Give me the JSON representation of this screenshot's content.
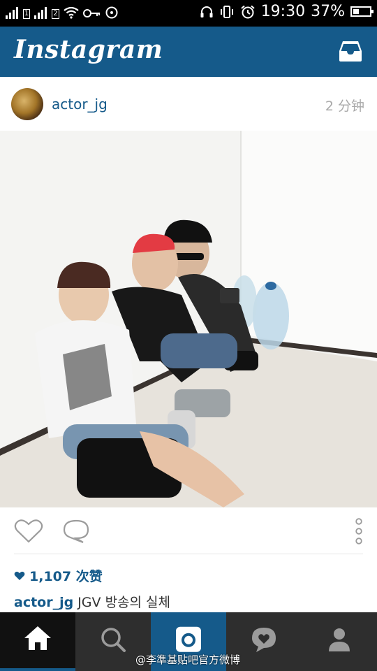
{
  "status_bar": {
    "sim1": "1",
    "sim2": "2",
    "time": "19:30",
    "battery_percent": "37%",
    "battery_level": 0.37
  },
  "header": {
    "logo": "Instagram",
    "inbox_icon": "inbox-tray-icon"
  },
  "post": {
    "username": "actor_jg",
    "time_ago": "2 分钟",
    "likes": "1,107 次赞",
    "caption_user": "actor_jg",
    "caption_text": "JGV 방송의 실체"
  },
  "bottom_nav": {
    "tabs": [
      "home-icon",
      "search-icon",
      "camera-icon",
      "activity-heart-icon",
      "profile-icon"
    ],
    "active": "home"
  },
  "watermark": "@李準基贴吧官方微博",
  "colors": {
    "brand_blue": "#155a8a",
    "status_bar": "#000000",
    "nav_bar": "#2e2e2e"
  }
}
